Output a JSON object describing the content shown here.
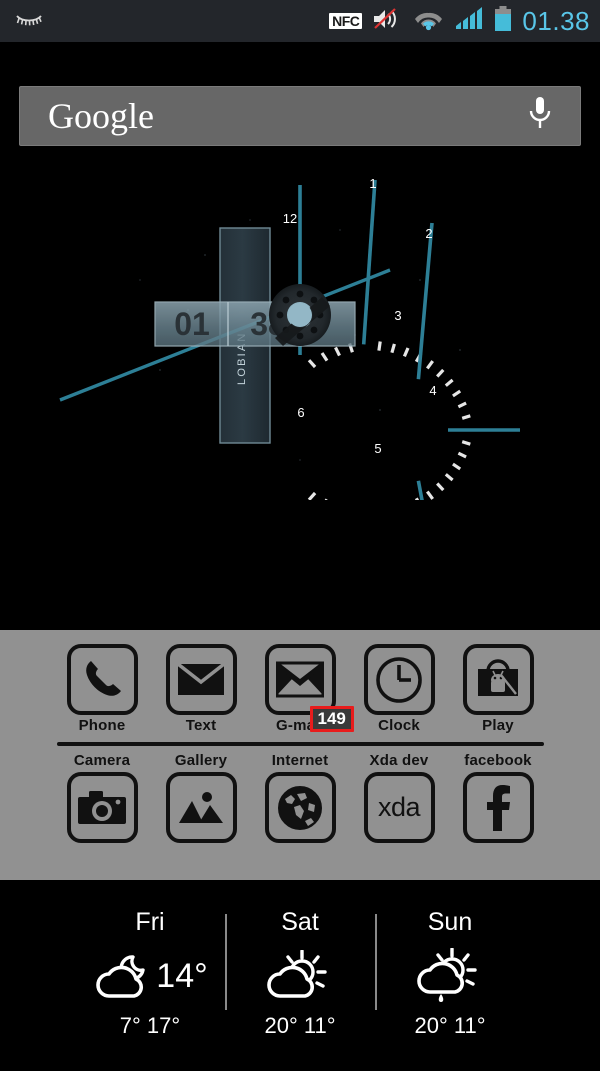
{
  "statusbar": {
    "left_icon": "smart-stay-eye-icon",
    "nfc_label": "NFC",
    "icons": [
      "volume-mute-icon",
      "wifi-icon",
      "signal-icon",
      "battery-icon"
    ],
    "time": "01.38"
  },
  "search": {
    "logo_text": "Google",
    "mic_icon": "microphone-icon"
  },
  "clock_widget": {
    "brand": "LOBIAN",
    "hours_digits": "01",
    "minutes_digits": "38",
    "hour_labels": [
      "12",
      "1",
      "2",
      "3",
      "4",
      "5",
      "6"
    ],
    "accent_color": "#2d7f96",
    "tick_color": "#e6e6e6",
    "hub_color": "#8fb5c4"
  },
  "dock": {
    "background": "#919191",
    "row1": [
      {
        "label": "Phone",
        "icon": "phone-icon"
      },
      {
        "label": "Text",
        "icon": "envelope-icon"
      },
      {
        "label": "G-mail",
        "icon": "gmail-icon",
        "badge": "149"
      },
      {
        "label": "Clock",
        "icon": "clock-icon"
      },
      {
        "label": "Play",
        "icon": "play-store-bag-icon"
      }
    ],
    "row2": [
      {
        "label": "Camera",
        "icon": "camera-icon"
      },
      {
        "label": "Gallery",
        "icon": "gallery-mountain-icon"
      },
      {
        "label": "Internet",
        "icon": "globe-icon"
      },
      {
        "label": "Xda dev",
        "icon": "xda-text-icon",
        "text": "xda"
      },
      {
        "label": "facebook",
        "icon": "facebook-f-icon"
      }
    ]
  },
  "weather": {
    "days": [
      {
        "day": "Fri",
        "icon": "moon-cloud-icon",
        "temp": "14°",
        "lohi": "7° 17°"
      },
      {
        "day": "Sat",
        "icon": "sun-cloud-icon",
        "temp": "",
        "lohi": "20° 11°"
      },
      {
        "day": "Sun",
        "icon": "sun-cloud-rain-icon",
        "temp": "",
        "lohi": "20° 11°"
      }
    ]
  }
}
